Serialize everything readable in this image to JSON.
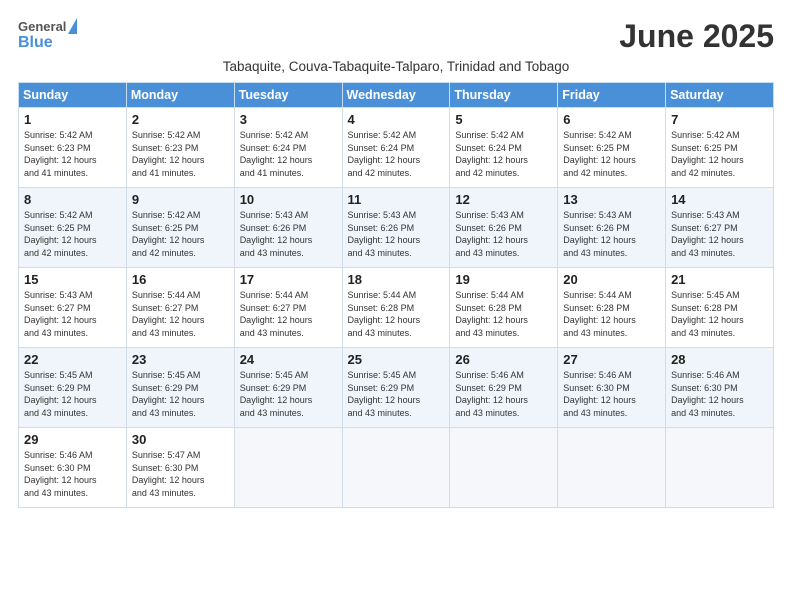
{
  "header": {
    "logo_general": "General",
    "logo_blue": "Blue",
    "month_title": "June 2025",
    "subtitle": "Tabaquite, Couva-Tabaquite-Talparo, Trinidad and Tobago"
  },
  "days_of_week": [
    "Sunday",
    "Monday",
    "Tuesday",
    "Wednesday",
    "Thursday",
    "Friday",
    "Saturday"
  ],
  "weeks": [
    [
      {
        "day": "1",
        "lines": [
          "Sunrise: 5:42 AM",
          "Sunset: 6:23 PM",
          "Daylight: 12 hours",
          "and 41 minutes."
        ]
      },
      {
        "day": "2",
        "lines": [
          "Sunrise: 5:42 AM",
          "Sunset: 6:23 PM",
          "Daylight: 12 hours",
          "and 41 minutes."
        ]
      },
      {
        "day": "3",
        "lines": [
          "Sunrise: 5:42 AM",
          "Sunset: 6:24 PM",
          "Daylight: 12 hours",
          "and 41 minutes."
        ]
      },
      {
        "day": "4",
        "lines": [
          "Sunrise: 5:42 AM",
          "Sunset: 6:24 PM",
          "Daylight: 12 hours",
          "and 42 minutes."
        ]
      },
      {
        "day": "5",
        "lines": [
          "Sunrise: 5:42 AM",
          "Sunset: 6:24 PM",
          "Daylight: 12 hours",
          "and 42 minutes."
        ]
      },
      {
        "day": "6",
        "lines": [
          "Sunrise: 5:42 AM",
          "Sunset: 6:25 PM",
          "Daylight: 12 hours",
          "and 42 minutes."
        ]
      },
      {
        "day": "7",
        "lines": [
          "Sunrise: 5:42 AM",
          "Sunset: 6:25 PM",
          "Daylight: 12 hours",
          "and 42 minutes."
        ]
      }
    ],
    [
      {
        "day": "8",
        "lines": [
          "Sunrise: 5:42 AM",
          "Sunset: 6:25 PM",
          "Daylight: 12 hours",
          "and 42 minutes."
        ]
      },
      {
        "day": "9",
        "lines": [
          "Sunrise: 5:42 AM",
          "Sunset: 6:25 PM",
          "Daylight: 12 hours",
          "and 42 minutes."
        ]
      },
      {
        "day": "10",
        "lines": [
          "Sunrise: 5:43 AM",
          "Sunset: 6:26 PM",
          "Daylight: 12 hours",
          "and 43 minutes."
        ]
      },
      {
        "day": "11",
        "lines": [
          "Sunrise: 5:43 AM",
          "Sunset: 6:26 PM",
          "Daylight: 12 hours",
          "and 43 minutes."
        ]
      },
      {
        "day": "12",
        "lines": [
          "Sunrise: 5:43 AM",
          "Sunset: 6:26 PM",
          "Daylight: 12 hours",
          "and 43 minutes."
        ]
      },
      {
        "day": "13",
        "lines": [
          "Sunrise: 5:43 AM",
          "Sunset: 6:26 PM",
          "Daylight: 12 hours",
          "and 43 minutes."
        ]
      },
      {
        "day": "14",
        "lines": [
          "Sunrise: 5:43 AM",
          "Sunset: 6:27 PM",
          "Daylight: 12 hours",
          "and 43 minutes."
        ]
      }
    ],
    [
      {
        "day": "15",
        "lines": [
          "Sunrise: 5:43 AM",
          "Sunset: 6:27 PM",
          "Daylight: 12 hours",
          "and 43 minutes."
        ]
      },
      {
        "day": "16",
        "lines": [
          "Sunrise: 5:44 AM",
          "Sunset: 6:27 PM",
          "Daylight: 12 hours",
          "and 43 minutes."
        ]
      },
      {
        "day": "17",
        "lines": [
          "Sunrise: 5:44 AM",
          "Sunset: 6:27 PM",
          "Daylight: 12 hours",
          "and 43 minutes."
        ]
      },
      {
        "day": "18",
        "lines": [
          "Sunrise: 5:44 AM",
          "Sunset: 6:28 PM",
          "Daylight: 12 hours",
          "and 43 minutes."
        ]
      },
      {
        "day": "19",
        "lines": [
          "Sunrise: 5:44 AM",
          "Sunset: 6:28 PM",
          "Daylight: 12 hours",
          "and 43 minutes."
        ]
      },
      {
        "day": "20",
        "lines": [
          "Sunrise: 5:44 AM",
          "Sunset: 6:28 PM",
          "Daylight: 12 hours",
          "and 43 minutes."
        ]
      },
      {
        "day": "21",
        "lines": [
          "Sunrise: 5:45 AM",
          "Sunset: 6:28 PM",
          "Daylight: 12 hours",
          "and 43 minutes."
        ]
      }
    ],
    [
      {
        "day": "22",
        "lines": [
          "Sunrise: 5:45 AM",
          "Sunset: 6:29 PM",
          "Daylight: 12 hours",
          "and 43 minutes."
        ]
      },
      {
        "day": "23",
        "lines": [
          "Sunrise: 5:45 AM",
          "Sunset: 6:29 PM",
          "Daylight: 12 hours",
          "and 43 minutes."
        ]
      },
      {
        "day": "24",
        "lines": [
          "Sunrise: 5:45 AM",
          "Sunset: 6:29 PM",
          "Daylight: 12 hours",
          "and 43 minutes."
        ]
      },
      {
        "day": "25",
        "lines": [
          "Sunrise: 5:45 AM",
          "Sunset: 6:29 PM",
          "Daylight: 12 hours",
          "and 43 minutes."
        ]
      },
      {
        "day": "26",
        "lines": [
          "Sunrise: 5:46 AM",
          "Sunset: 6:29 PM",
          "Daylight: 12 hours",
          "and 43 minutes."
        ]
      },
      {
        "day": "27",
        "lines": [
          "Sunrise: 5:46 AM",
          "Sunset: 6:30 PM",
          "Daylight: 12 hours",
          "and 43 minutes."
        ]
      },
      {
        "day": "28",
        "lines": [
          "Sunrise: 5:46 AM",
          "Sunset: 6:30 PM",
          "Daylight: 12 hours",
          "and 43 minutes."
        ]
      }
    ],
    [
      {
        "day": "29",
        "lines": [
          "Sunrise: 5:46 AM",
          "Sunset: 6:30 PM",
          "Daylight: 12 hours",
          "and 43 minutes."
        ]
      },
      {
        "day": "30",
        "lines": [
          "Sunrise: 5:47 AM",
          "Sunset: 6:30 PM",
          "Daylight: 12 hours",
          "and 43 minutes."
        ]
      },
      null,
      null,
      null,
      null,
      null
    ]
  ]
}
